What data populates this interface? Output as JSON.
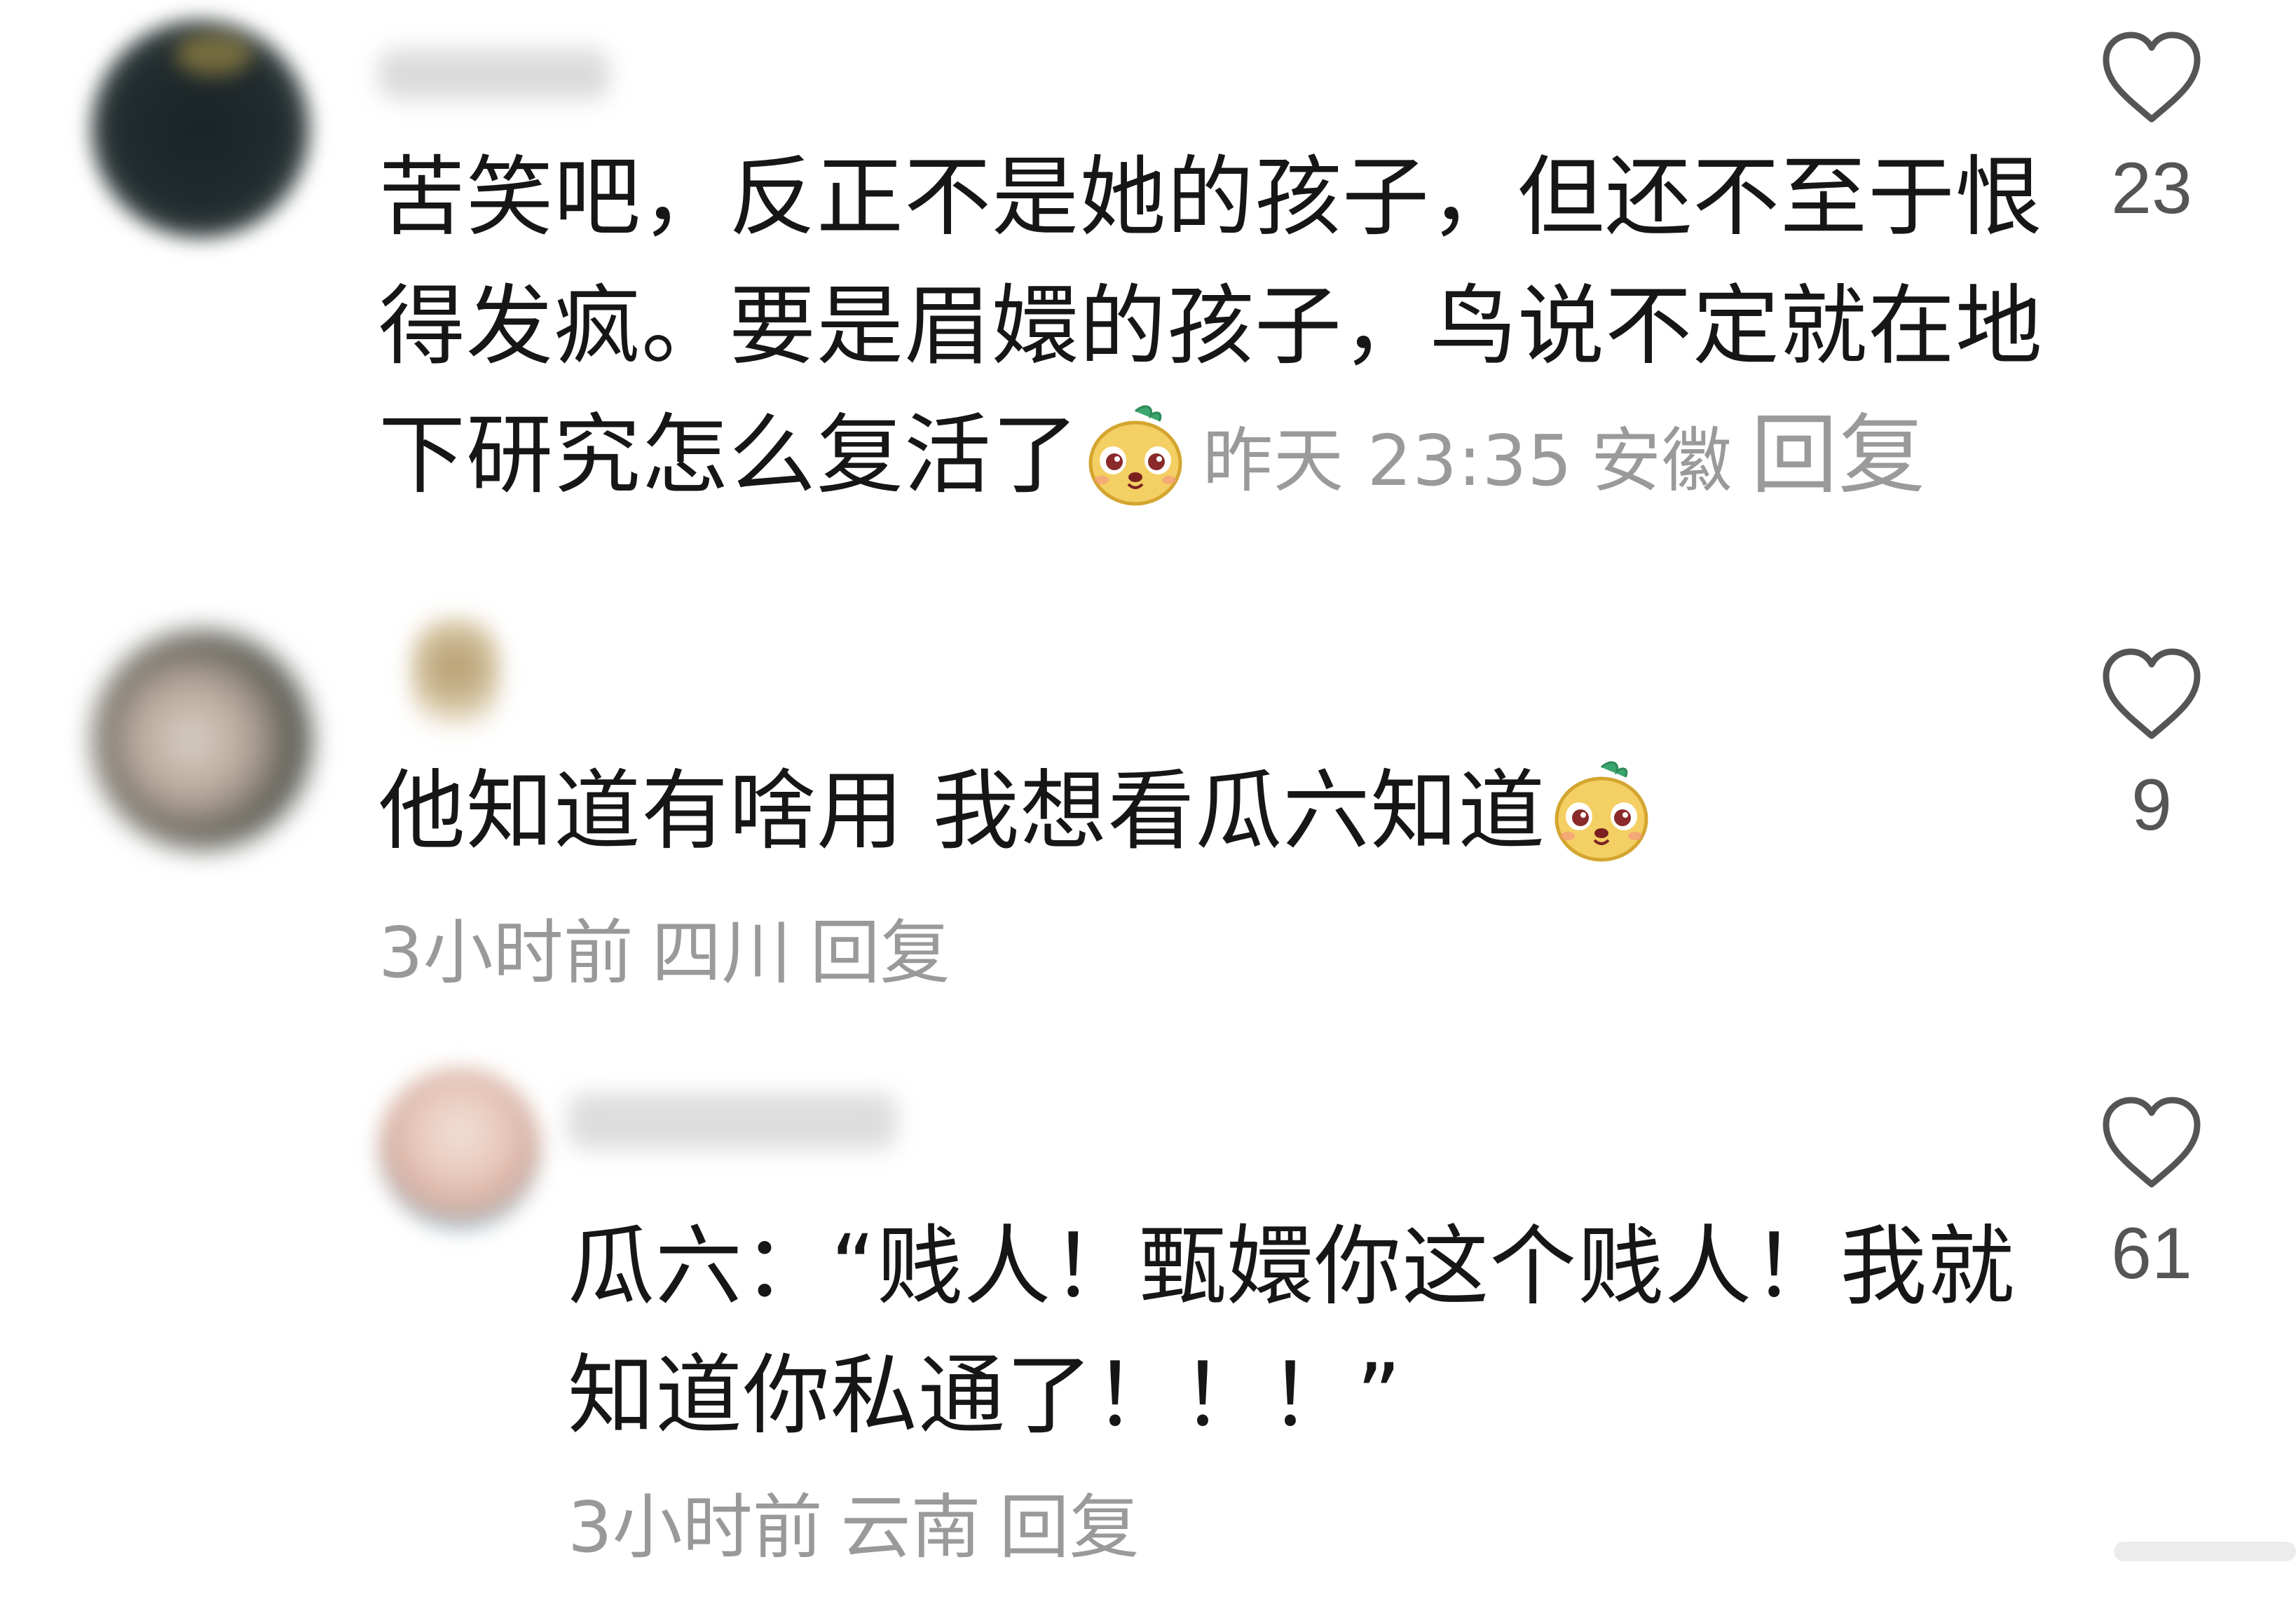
{
  "comments": [
    {
      "lines": [
        "苦笑吧，反正不是她的孩子，但还不至于恨",
        "得发疯。要是眉嬛的孩子，鸟说不定就在地",
        "下研究怎么复活了"
      ],
      "time": "昨天 23:35",
      "location": "安徽",
      "reply_label": "回复",
      "likes": "23",
      "emoji": "emoji-face"
    },
    {
      "lines": [
        "他知道有啥用 我想看瓜六知道"
      ],
      "time": "3小时前",
      "location": "四川",
      "reply_label": "回复",
      "likes": "9",
      "emoji": "emoji-face"
    },
    {
      "lines": [
        "瓜六：“贱人！甄嬛你这个贱人！我就",
        "知道你私通了！！！”"
      ],
      "time": "3小时前",
      "location": "云南",
      "reply_label": "回复",
      "likes": "61"
    }
  ],
  "icons": {
    "like": "heart-outline-icon",
    "emoji": "cute-face-emoji"
  },
  "colors": {
    "text": "#161616",
    "meta": "#9a9a9a",
    "like_count": "#555555"
  }
}
